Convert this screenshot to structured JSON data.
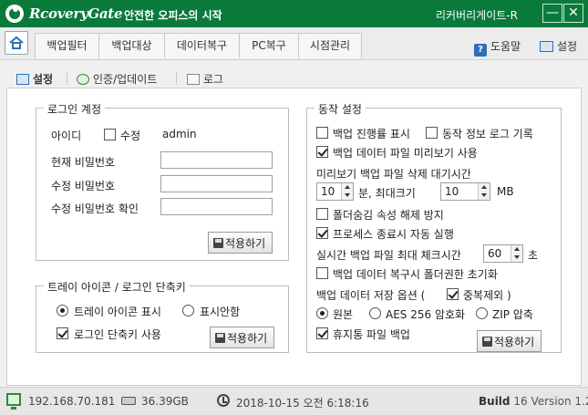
{
  "titlebar": {
    "brand": "RcoveryGate",
    "slogan": "안전한 오피스의 시작",
    "app_name": "리커버리게이트-R",
    "minimize": "—",
    "close": "✕"
  },
  "menu": {
    "tabs": [
      "백업필터",
      "백업대상",
      "데이터복구",
      "PC복구",
      "시점관리"
    ],
    "help": "도움말",
    "settings": "설정"
  },
  "subtabs": {
    "settings": "설정",
    "auth_update": "인증/업데이트",
    "log": "로그"
  },
  "login": {
    "legend": "로그인 계정",
    "id_label": "아이디",
    "edit_label": "수정",
    "edit_checked": false,
    "id_value": "admin",
    "current_pw": "현재 비밀번호",
    "new_pw": "수정 비밀번호",
    "confirm_pw": "수정 비밀번호 확인",
    "apply": "적용하기"
  },
  "tray": {
    "legend": "트레이 아이콘 / 로그인 단축키",
    "show_icon": "트레이 아이콘 표시",
    "hide_icon": "표시안함",
    "show_selected": true,
    "shortcut": "로그인 단축키 사용",
    "shortcut_checked": true,
    "apply": "적용하기"
  },
  "behavior": {
    "legend": "동작 설정",
    "show_progress": "백업 진행률 표시",
    "show_progress_checked": false,
    "log_info": "동작 정보 로그 기록",
    "log_info_checked": false,
    "preview": "백업 데이터 파일 미리보기 사용",
    "preview_checked": true,
    "preview_wait": "미리보기 백업 파일 삭제 대기시간",
    "minutes_value": "10",
    "minutes_unit": "분, 최대크기",
    "maxsize_value": "10",
    "maxsize_unit": "MB",
    "folder_hidden": "폴더숨김 속성 해제 방지",
    "folder_hidden_checked": false,
    "auto_run": "프로세스 종료시 자동 실행",
    "auto_run_checked": true,
    "realtime_check": "실시간 백업 파일 최대 체크시간",
    "realtime_value": "60",
    "realtime_unit": "초",
    "init_perm": "백업 데이터 복구시 폴더권한 초기화",
    "init_perm_checked": false,
    "storage_option": "백업 데이터 저장 옵션 (",
    "dedup": "중복제외 )",
    "dedup_checked": true,
    "original": "원본",
    "aes": "AES 256 암호화",
    "zip": "ZIP 압축",
    "storage_selected": "원본",
    "recycle": "휴지통 파일 백업",
    "recycle_checked": true,
    "apply": "적용하기"
  },
  "status": {
    "ip": "192.168.70.181",
    "disk": "36.39GB",
    "datetime": "2018-10-15 오전 6:18:16",
    "build_label": "Build",
    "build_number": "16",
    "version": "Version 1.2"
  },
  "colors": {
    "titlebar": "#0a7a3b",
    "accent": "#2e6fb7"
  }
}
